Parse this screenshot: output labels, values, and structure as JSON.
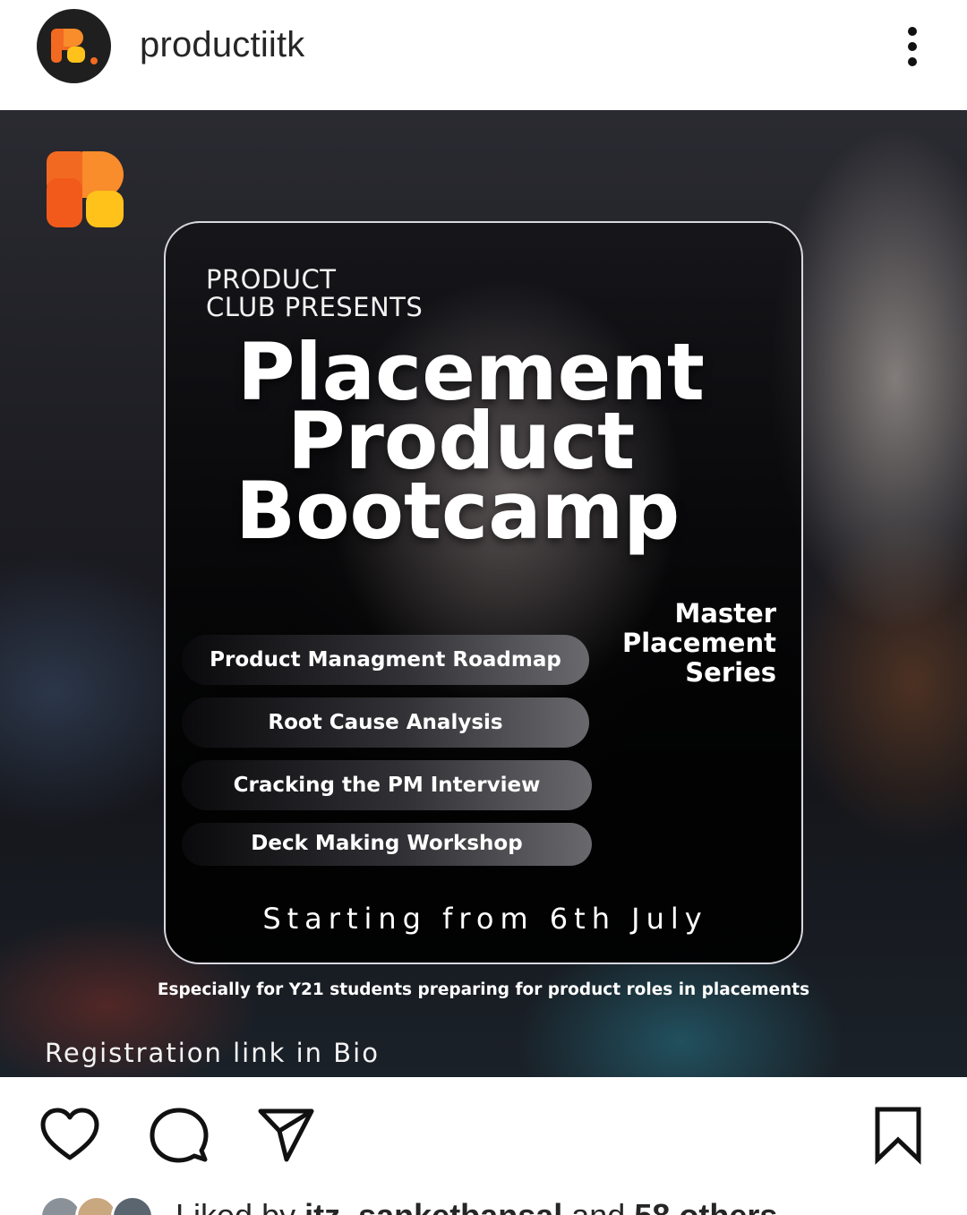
{
  "header": {
    "username": "productiitk",
    "avatar_icon": "brand-r-logo-icon",
    "more_icon": "more-vertical-icon"
  },
  "post": {
    "presents_line1": "PRODUCT",
    "presents_line2": "CLUB PRESENTS",
    "title_line1": "Placement",
    "title_line2": "Product",
    "title_line3": "Bootcamp",
    "series_line1": "Master",
    "series_line2": "Placement",
    "series_line3": "Series",
    "topics": [
      "Product Managment Roadmap",
      "Root Cause Analysis",
      "Cracking the PM Interview",
      "Deck Making Workshop"
    ],
    "starting": "Starting from 6th July",
    "especially": "Especially for Y21 students preparing for product roles in placements",
    "registration": "Registration link in Bio"
  },
  "actions": {
    "like_icon": "heart-icon",
    "comment_icon": "comment-icon",
    "share_icon": "send-icon",
    "save_icon": "bookmark-icon"
  },
  "likes": {
    "prefix": "Liked by",
    "user": "itz_sanketbansal",
    "middle": "and",
    "count": "58 others"
  },
  "colors": {
    "logo_orange": "#f26a21",
    "logo_yellow": "#ffc21a",
    "text_dark": "#262626"
  }
}
